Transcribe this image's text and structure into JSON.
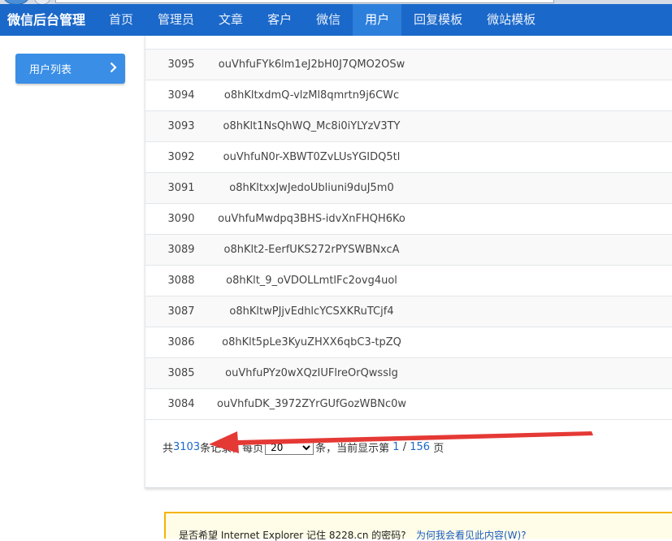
{
  "nav": {
    "brand": "微信后台管理",
    "items": [
      {
        "label": "首页"
      },
      {
        "label": "管理员"
      },
      {
        "label": "文章"
      },
      {
        "label": "客户"
      },
      {
        "label": "微信"
      },
      {
        "label": "用户",
        "active": true
      },
      {
        "label": "回复模板"
      },
      {
        "label": "微站模板"
      }
    ]
  },
  "sidebar": {
    "item_label": "用户列表",
    "icon": "chevron-right-icon"
  },
  "table": {
    "rows": [
      {
        "id": "3095",
        "openid": "ouVhfuFYk6lm1eJ2bH0J7QMO2OSw"
      },
      {
        "id": "3094",
        "openid": "o8hKltxdmQ-vlzMl8qmrtn9j6CWc"
      },
      {
        "id": "3093",
        "openid": "o8hKlt1NsQhWQ_Mc8i0iYLYzV3TY"
      },
      {
        "id": "3092",
        "openid": "ouVhfuN0r-XBWT0ZvLUsYGIDQ5tl"
      },
      {
        "id": "3091",
        "openid": "o8hKltxxJwJedoUbliuni9duJ5m0"
      },
      {
        "id": "3090",
        "openid": "ouVhfuMwdpq3BHS-idvXnFHQH6Ko"
      },
      {
        "id": "3089",
        "openid": "o8hKlt2-EerfUKS272rPYSWBNxcA"
      },
      {
        "id": "3088",
        "openid": "o8hKlt_9_oVDOLLmtlFc2ovg4uol"
      },
      {
        "id": "3087",
        "openid": "o8hKltwPJjvEdhlcYCSXKRuTCjf4"
      },
      {
        "id": "3086",
        "openid": "o8hKlt5pLe3KyuZHXX6qbC3-tpZQ"
      },
      {
        "id": "3085",
        "openid": "ouVhfuPYz0wXQzIUFlreOrQwsslg"
      },
      {
        "id": "3084",
        "openid": "ouVhfuDK_3972ZYrGUfGozWBNc0w"
      }
    ]
  },
  "pager": {
    "prefix": "共",
    "total": "3103",
    "records": "条记录，每页",
    "per_page": "20",
    "per_suffix": "条，当前显示第",
    "current_page": "1",
    "slash": "/",
    "total_pages": "156",
    "page_suffix": "页"
  },
  "annotation": {
    "color": "#e53935",
    "icon": "red-arrow"
  },
  "ie_bar": {
    "question": "是否希望 Internet Explorer 记住 8228.cn 的密码?",
    "link": "为何我会看见此内容(W)?"
  },
  "colors": {
    "nav": "#1a68ca",
    "nav_active": "#2d7fdc",
    "sidebar_button": "#3a8ee6",
    "link": "#1a68ca"
  }
}
